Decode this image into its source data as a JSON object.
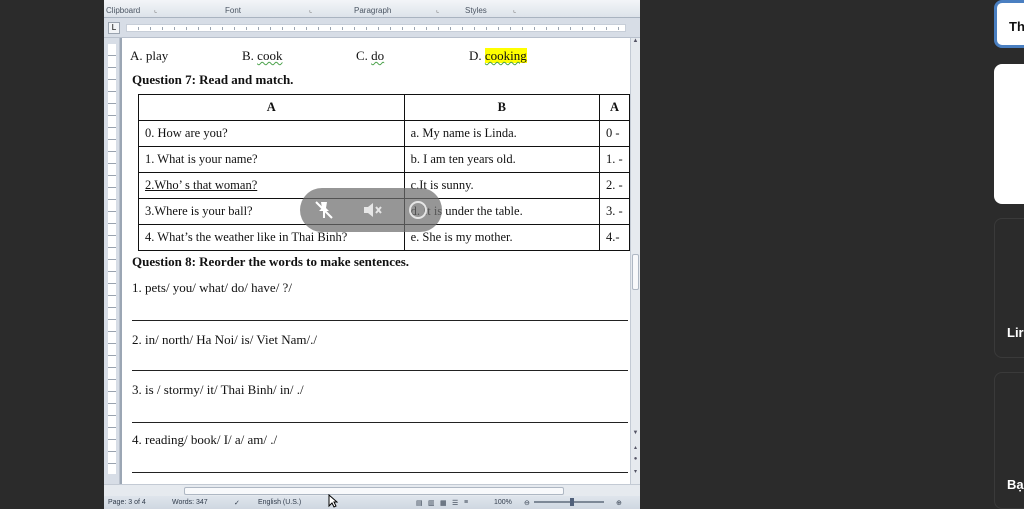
{
  "ribbon": {
    "groups": [
      "Clipboard",
      "Font",
      "Paragraph",
      "Styles"
    ]
  },
  "document": {
    "options_line": {
      "a": "A. play",
      "b_prefix": "B. ",
      "b_word": "cook",
      "c_prefix": "C. ",
      "c_word": "do",
      "d_prefix": "D. ",
      "d_word": "cooking"
    },
    "question7": "Question 7:  Read and match.",
    "table": {
      "headers": [
        "A",
        "B",
        "A"
      ],
      "rows": [
        [
          "0. How are you?",
          "a. My name is Linda.",
          "0 -"
        ],
        [
          "1. What is your name?",
          "b. I am ten years old.",
          "1. -"
        ],
        [
          "2.Who’ s that woman?",
          "c.It is sunny.",
          "2. -"
        ],
        [
          "3.Where is your ball?",
          "d. It is under the table.",
          "3. -"
        ],
        [
          "4. What’s the weather like in Thai Binh?",
          "e. She is my mother.",
          "4.-"
        ]
      ]
    },
    "question8": "Question 8: Reorder the words to make sentences.",
    "items": [
      "1. pets/ you/ what/ do/ have/ ?/",
      "2. in/ north/ Ha Noi/ is/ Viet Nam/./",
      "3. is / stormy/ it/ Thai Binh/ in/ ./",
      "4. reading/ book/ I/ a/ am/ ./"
    ]
  },
  "statusbar": {
    "page": "Page: 3 of 4",
    "words": "Words: 347",
    "language": "English (U.S.)",
    "zoom": "100%"
  },
  "overlay": {
    "icons": [
      "unpin-icon",
      "mute-icon",
      "minimize-icon"
    ]
  },
  "side_panel": {
    "card1_label": "Th",
    "card2_label": "Lir",
    "card3_label": "Bạ"
  }
}
